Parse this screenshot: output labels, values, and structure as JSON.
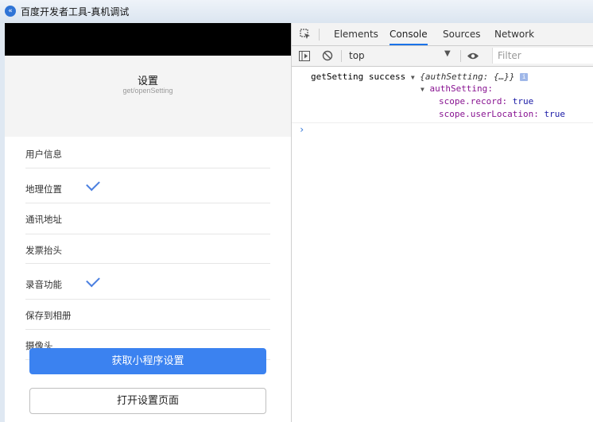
{
  "window": {
    "title": "百度开发者工具-真机调试"
  },
  "page": {
    "title": "设置",
    "subtitle": "get/openSetting"
  },
  "settings": [
    {
      "label": "用户信息",
      "checked": false
    },
    {
      "label": "地理位置",
      "checked": true
    },
    {
      "label": "通讯地址",
      "checked": false
    },
    {
      "label": "发票抬头",
      "checked": false
    },
    {
      "label": "录音功能",
      "checked": true
    },
    {
      "label": "保存到相册",
      "checked": false
    },
    {
      "label": "摄像头",
      "checked": false
    }
  ],
  "buttons": {
    "get_settings": "获取小程序设置",
    "open_settings": "打开设置页面"
  },
  "devtools": {
    "tabs": [
      "Elements",
      "Console",
      "Sources",
      "Network"
    ],
    "active_tab": "Console",
    "context": "top",
    "filter_placeholder": "Filter",
    "log": {
      "message": "getSetting success",
      "preview": "{authSetting: {…}}",
      "key": "authSetting",
      "props": [
        {
          "key": "scope.record",
          "value": "true"
        },
        {
          "key": "scope.userLocation",
          "value": "true"
        }
      ]
    }
  },
  "colors": {
    "accent": "#3b82f0",
    "check": "#4a7fe0",
    "devtools_tab": "#1a73e8"
  }
}
